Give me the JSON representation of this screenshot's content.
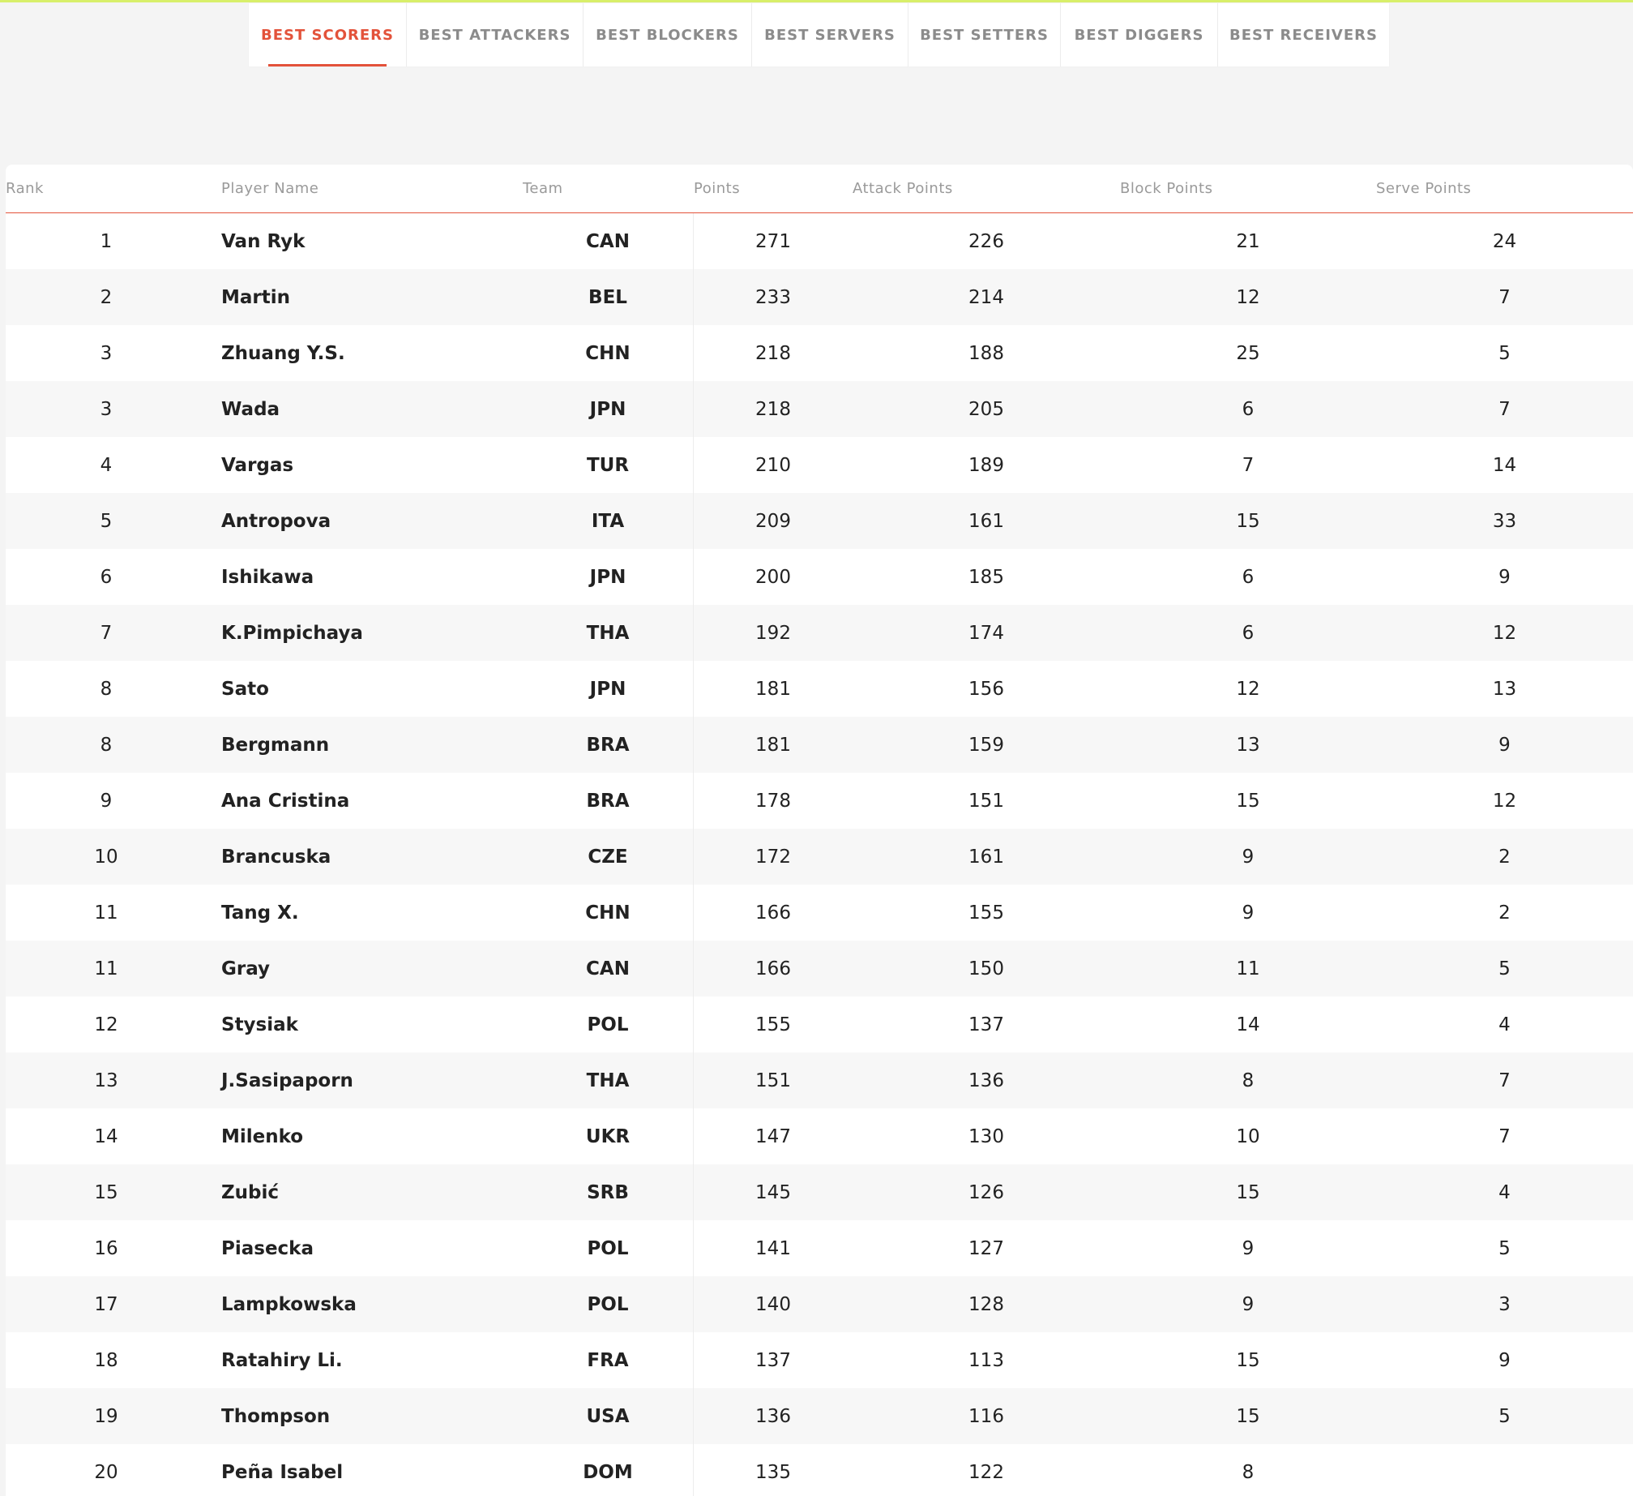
{
  "tabs": [
    {
      "label": "BEST SCORERS",
      "active": true
    },
    {
      "label": "BEST ATTACKERS",
      "active": false
    },
    {
      "label": "BEST BLOCKERS",
      "active": false
    },
    {
      "label": "BEST SERVERS",
      "active": false
    },
    {
      "label": "BEST SETTERS",
      "active": false
    },
    {
      "label": "BEST DIGGERS",
      "active": false
    },
    {
      "label": "BEST RECEIVERS",
      "active": false
    }
  ],
  "table": {
    "headers": {
      "rank": "Rank",
      "player": "Player Name",
      "team": "Team",
      "points": "Points",
      "attack": "Attack Points",
      "block": "Block Points",
      "serve": "Serve Points"
    },
    "rows": [
      {
        "rank": "1",
        "player": "Van Ryk",
        "team": "CAN",
        "points": "271",
        "attack": "226",
        "block": "21",
        "serve": "24"
      },
      {
        "rank": "2",
        "player": "Martin",
        "team": "BEL",
        "points": "233",
        "attack": "214",
        "block": "12",
        "serve": "7"
      },
      {
        "rank": "3",
        "player": "Zhuang Y.S.",
        "team": "CHN",
        "points": "218",
        "attack": "188",
        "block": "25",
        "serve": "5"
      },
      {
        "rank": "3",
        "player": "Wada",
        "team": "JPN",
        "points": "218",
        "attack": "205",
        "block": "6",
        "serve": "7"
      },
      {
        "rank": "4",
        "player": "Vargas",
        "team": "TUR",
        "points": "210",
        "attack": "189",
        "block": "7",
        "serve": "14"
      },
      {
        "rank": "5",
        "player": "Antropova",
        "team": "ITA",
        "points": "209",
        "attack": "161",
        "block": "15",
        "serve": "33"
      },
      {
        "rank": "6",
        "player": "Ishikawa",
        "team": "JPN",
        "points": "200",
        "attack": "185",
        "block": "6",
        "serve": "9"
      },
      {
        "rank": "7",
        "player": "K.Pimpichaya",
        "team": "THA",
        "points": "192",
        "attack": "174",
        "block": "6",
        "serve": "12"
      },
      {
        "rank": "8",
        "player": "Sato",
        "team": "JPN",
        "points": "181",
        "attack": "156",
        "block": "12",
        "serve": "13"
      },
      {
        "rank": "8",
        "player": "Bergmann",
        "team": "BRA",
        "points": "181",
        "attack": "159",
        "block": "13",
        "serve": "9"
      },
      {
        "rank": "9",
        "player": "Ana Cristina",
        "team": "BRA",
        "points": "178",
        "attack": "151",
        "block": "15",
        "serve": "12"
      },
      {
        "rank": "10",
        "player": "Brancuska",
        "team": "CZE",
        "points": "172",
        "attack": "161",
        "block": "9",
        "serve": "2"
      },
      {
        "rank": "11",
        "player": "Tang X.",
        "team": "CHN",
        "points": "166",
        "attack": "155",
        "block": "9",
        "serve": "2"
      },
      {
        "rank": "11",
        "player": "Gray",
        "team": "CAN",
        "points": "166",
        "attack": "150",
        "block": "11",
        "serve": "5"
      },
      {
        "rank": "12",
        "player": "Stysiak",
        "team": "POL",
        "points": "155",
        "attack": "137",
        "block": "14",
        "serve": "4"
      },
      {
        "rank": "13",
        "player": "J.Sasipaporn",
        "team": "THA",
        "points": "151",
        "attack": "136",
        "block": "8",
        "serve": "7"
      },
      {
        "rank": "14",
        "player": "Milenko",
        "team": "UKR",
        "points": "147",
        "attack": "130",
        "block": "10",
        "serve": "7"
      },
      {
        "rank": "15",
        "player": "Zubić",
        "team": "SRB",
        "points": "145",
        "attack": "126",
        "block": "15",
        "serve": "4"
      },
      {
        "rank": "16",
        "player": "Piasecka",
        "team": "POL",
        "points": "141",
        "attack": "127",
        "block": "9",
        "serve": "5"
      },
      {
        "rank": "17",
        "player": "Lampkowska",
        "team": "POL",
        "points": "140",
        "attack": "128",
        "block": "9",
        "serve": "3"
      },
      {
        "rank": "18",
        "player": "Ratahiry Li.",
        "team": "FRA",
        "points": "137",
        "attack": "113",
        "block": "15",
        "serve": "9"
      },
      {
        "rank": "19",
        "player": "Thompson",
        "team": "USA",
        "points": "136",
        "attack": "116",
        "block": "15",
        "serve": "5"
      },
      {
        "rank": "20",
        "player": "Peña Isabel",
        "team": "DOM",
        "points": "135",
        "attack": "122",
        "block": "8",
        "serve": ""
      }
    ]
  },
  "colors": {
    "accent": "#e3523a",
    "top_bar": "#d8ef6a",
    "background": "#f4f4f4"
  }
}
